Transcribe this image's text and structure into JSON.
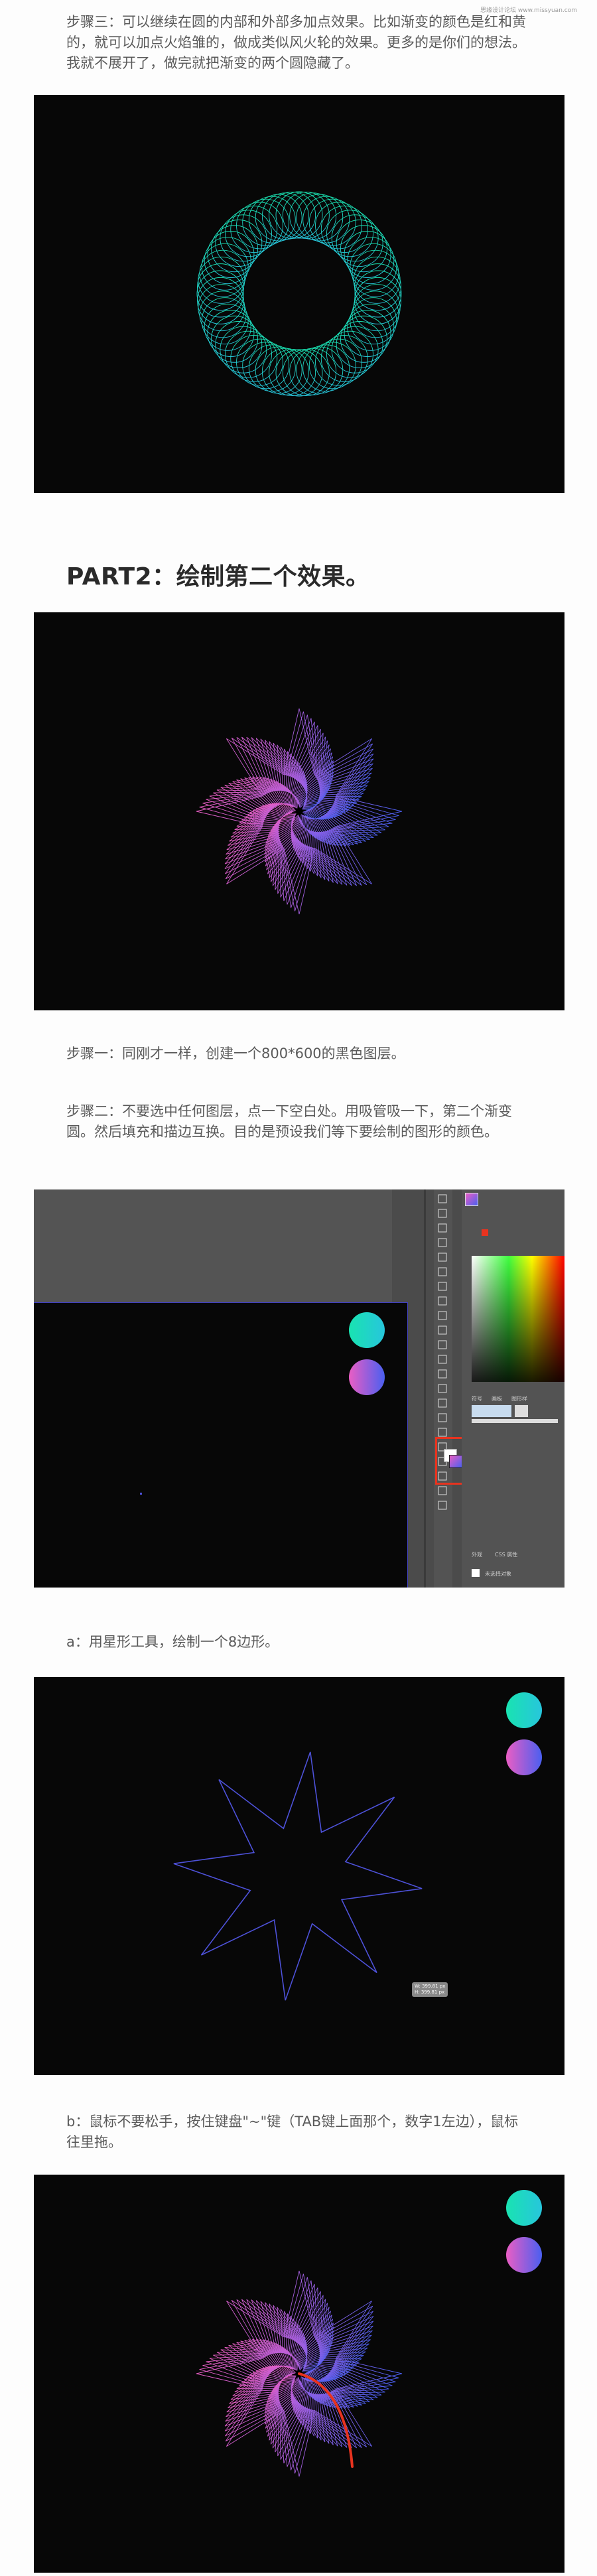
{
  "watermark": "思缘设计论坛 www.missyuan.com",
  "step3_text": "步骤三：可以继续在圆的内部和外部多加点效果。比如渐变的颜色是红和黄的，就可以加点火焰雏的，做成类似风火轮的效果。更多的是你们的想法。我就不展开了，做完就把渐变的两个圆隐藏了。",
  "part2_heading": "PART2：绘制第二个效果。",
  "step1_text": "步骤一：同刚才一样，创建一个800*600的黑色图层。",
  "step2_text": "步骤二：不要选中任何图层，点一下空白处。用吸管吸一下，第二个渐变圆。然后填充和描边互换。目的是预设我们等下要绘制的图形的颜色。",
  "step_a_text": "a：用星形工具，绘制一个8边形。",
  "step_b_text": "b：鼠标不要松手，按住键盘\"~\"键（TAB键上面那个，数字1左边），鼠标往里拖。",
  "ui": {
    "panel_tab_1": "符号",
    "panel_tab_2": "画板",
    "panel_tab_3": "图形样",
    "layers_tab_1": "外观",
    "layers_tab_2": "CSS 属性",
    "no_selection": "未选择对象",
    "tooltip_w": "W: 399.81 px",
    "tooltip_h": "H: 399.81 px"
  },
  "colors": {
    "teal": "#19e3b1",
    "aqua": "#27c6dc",
    "pink": "#ea5ec4",
    "purple": "#a55fe0",
    "blue": "#4a5ff0",
    "star_stroke": "#4d51d8",
    "highlight": "#e8331f"
  }
}
